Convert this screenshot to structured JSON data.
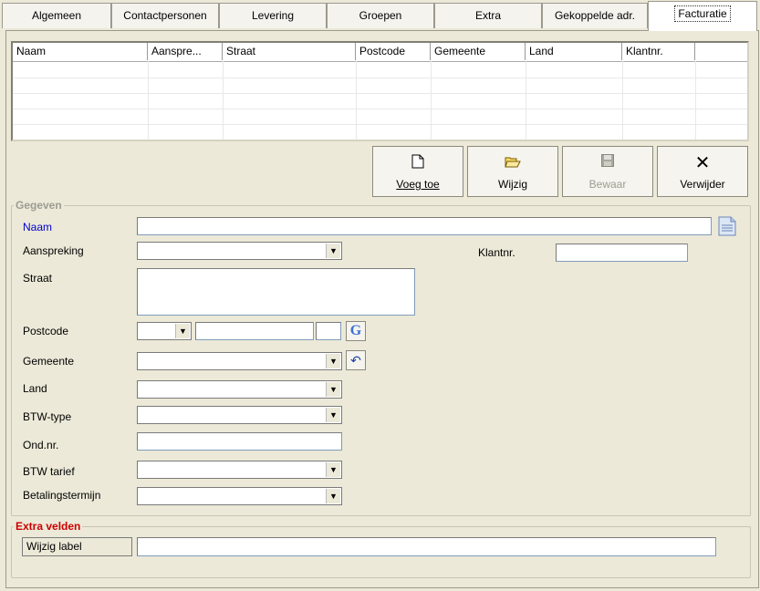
{
  "tabs": [
    {
      "label": "Algemeen"
    },
    {
      "label": "Contactpersonen"
    },
    {
      "label": "Levering"
    },
    {
      "label": "Groepen"
    },
    {
      "label": "Extra"
    },
    {
      "label": "Gekoppelde adr."
    },
    {
      "label": "Facturatie"
    }
  ],
  "grid": {
    "columns": [
      "Naam",
      "Aanspre...",
      "Straat",
      "Postcode",
      "Gemeente",
      "Land",
      "Klantnr."
    ]
  },
  "toolbar": {
    "add_label": "Voeg toe",
    "edit_label": "Wijzig",
    "save_label": "Bewaar",
    "delete_label": "Verwijder"
  },
  "gegevens": {
    "legend": "Gegeven",
    "naam_label": "Naam",
    "aanspreking_label": "Aanspreking",
    "klantnr_label": "Klantnr.",
    "straat_label": "Straat",
    "postcode_label": "Postcode",
    "gemeente_label": "Gemeente",
    "land_label": "Land",
    "btwtype_label": "BTW-type",
    "ondnr_label": "Ond.nr.",
    "btwtarief_label": "BTW tarief",
    "betalingstermijn_label": "Betalingstermijn",
    "google_glyph": "G"
  },
  "extra": {
    "legend": "Extra velden",
    "label_button": "Wijzig label"
  },
  "colors": {
    "accent_blue": "#0000cc",
    "extra_red": "#cc0000"
  }
}
